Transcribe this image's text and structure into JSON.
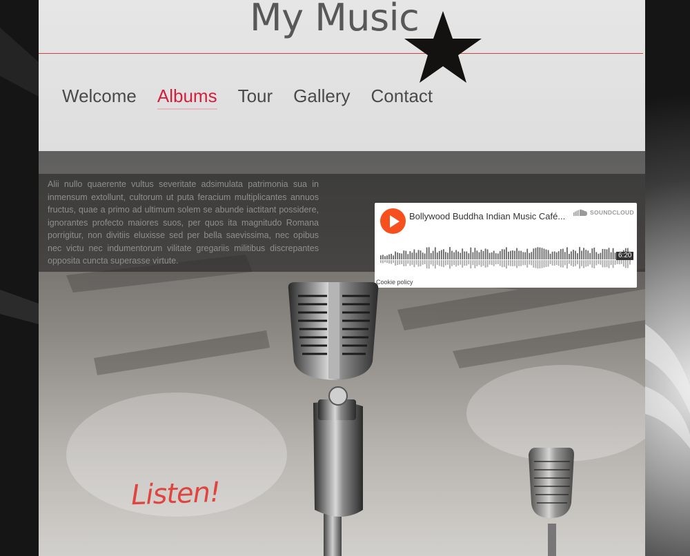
{
  "site": {
    "title": "My Music",
    "nav": [
      {
        "label": "Welcome",
        "active": false
      },
      {
        "label": "Albums",
        "active": true
      },
      {
        "label": "Tour",
        "active": false
      },
      {
        "label": "Gallery",
        "active": false
      },
      {
        "label": "Contact",
        "active": false
      }
    ]
  },
  "band": {
    "text": "Alii nullo quaerente vultus severitate adsimulata patrimonia sua in inmensum extollunt, cultorum ut puta feracium multiplicantes annuos fructus, quae a primo ad ultimum solem se abunde iactitant possidere, ignorantes profecto maiores suos, per quos ita magnitudo Romana porrigitur, non divitiis eluxisse sed per bella saevissima, nec opibus nec victu nec indumentorum vilitate gregariis militibus discrepantes opposita cuncta superasse virtute."
  },
  "player": {
    "track_title": "Bollywood Buddha Indian Music Café...",
    "brand": "SOUNDCLOUD",
    "duration": "6:20",
    "cookie_policy": "Cookie policy",
    "play_icon": "play-icon",
    "brand_icon": "soundcloud-icon"
  },
  "hero": {
    "caption": "Listen!"
  },
  "colors": {
    "accent": "#d31f3b",
    "rule": "#c9473f",
    "soundcloud_orange": "#f6501f",
    "caption": "#e0443f"
  }
}
